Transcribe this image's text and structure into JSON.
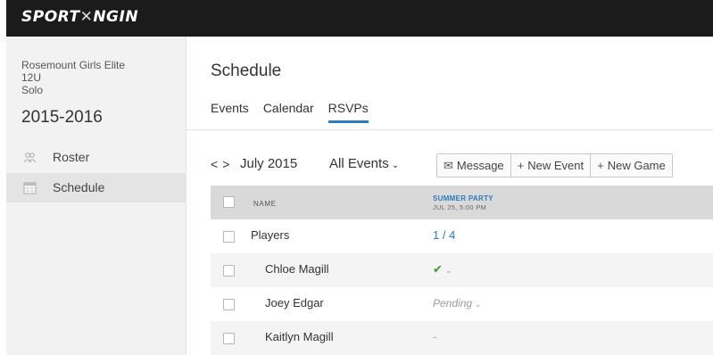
{
  "brand": {
    "logo_text_a": "SPORT",
    "logo_text_mark": "✕",
    "logo_text_b": "NGIN"
  },
  "sidebar": {
    "team_lines": [
      "Rosemount Girls Elite",
      "12U",
      "Solo"
    ],
    "season": "2015-2016",
    "items": [
      {
        "label": "Roster",
        "icon": "roster-icon",
        "active": false
      },
      {
        "label": "Schedule",
        "icon": "calendar-icon",
        "active": true
      }
    ]
  },
  "main": {
    "title": "Schedule",
    "tabs": [
      {
        "label": "Events",
        "active": false
      },
      {
        "label": "Calendar",
        "active": false
      },
      {
        "label": "RSVPs",
        "active": true
      }
    ],
    "toolbar": {
      "prev": "<",
      "next": ">",
      "month": "July 2015",
      "filter": "All Events",
      "filter_chevron": "⌄",
      "buttons": [
        {
          "label": "Message",
          "icon": "✉"
        },
        {
          "label": "New Event",
          "icon": "+"
        },
        {
          "label": "New Game",
          "icon": "+"
        }
      ]
    },
    "table": {
      "col_name": "NAME",
      "event_title": "SUMMER PARTY",
      "event_date": "JUL 25, 5:00 PM",
      "rows": [
        {
          "name": "Players",
          "value": "1 / 4",
          "kind": "count"
        },
        {
          "name": "Chloe Magill",
          "value": "✔",
          "kind": "yes",
          "chevron": "⌄"
        },
        {
          "name": "Joey Edgar",
          "value": "Pending",
          "kind": "pending",
          "chevron": "⌄"
        },
        {
          "name": "Kaitlyn Magill",
          "value": "-",
          "kind": "none"
        }
      ]
    }
  },
  "colors": {
    "accent": "#2a7bbf",
    "topbar": "#1b1b1b",
    "check": "#3a9a2b"
  }
}
